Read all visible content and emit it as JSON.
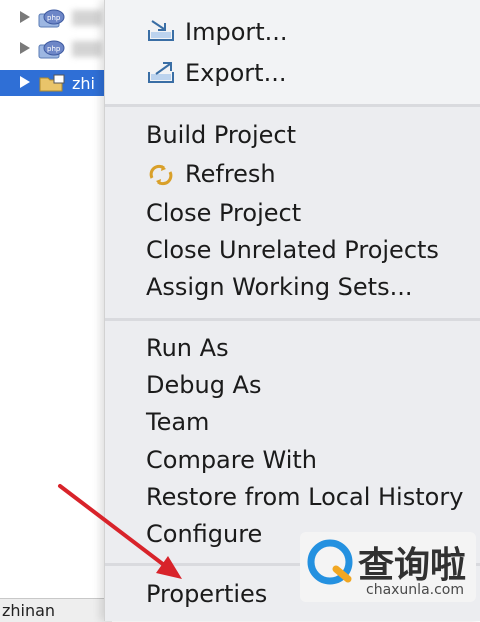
{
  "tree": {
    "rows": [
      {
        "label": ""
      },
      {
        "label": ""
      },
      {
        "label": "zhi"
      }
    ],
    "bottom_tab": "zhinan"
  },
  "menu": {
    "import": "Import...",
    "export": "Export...",
    "build_project": "Build Project",
    "refresh": "Refresh",
    "close_project": "Close Project",
    "close_unrelated": "Close Unrelated Projects",
    "assign_working_sets": "Assign Working Sets...",
    "run_as": "Run As",
    "debug_as": "Debug As",
    "team": "Team",
    "compare_with": "Compare With",
    "restore_history": "Restore from Local History",
    "configure": "Configure",
    "properties": "Properties"
  },
  "watermark": {
    "brand": "查询啦",
    "url": "chaxunla.com"
  },
  "colors": {
    "selection": "#2f6fd6",
    "arrow": "#d8232a",
    "menu_bg": "#ecedf0"
  }
}
